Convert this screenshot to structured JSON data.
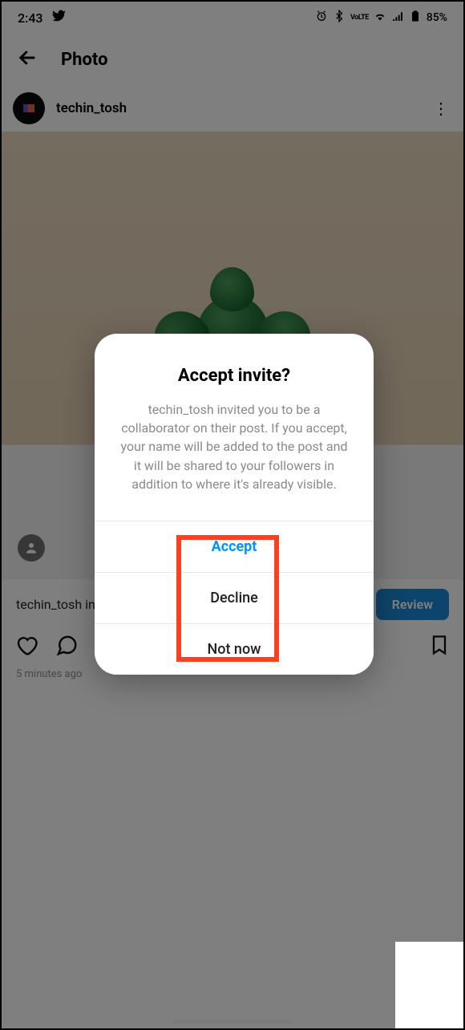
{
  "status": {
    "time": "2:43",
    "lte": "VoLTE",
    "battery": "85%"
  },
  "header": {
    "title": "Photo"
  },
  "post": {
    "username": "techin_tosh",
    "invite_snippet": "techin_tosh in",
    "review_label": "Review",
    "timestamp": "5 minutes ago"
  },
  "dialog": {
    "title": "Accept invite?",
    "body": "techin_tosh invited you to be a collaborator on their post. If you accept, your name will be added to the post and it will be shared to your followers in addition to where it's already visible.",
    "accept": "Accept",
    "decline": "Decline",
    "notnow": "Not now"
  }
}
